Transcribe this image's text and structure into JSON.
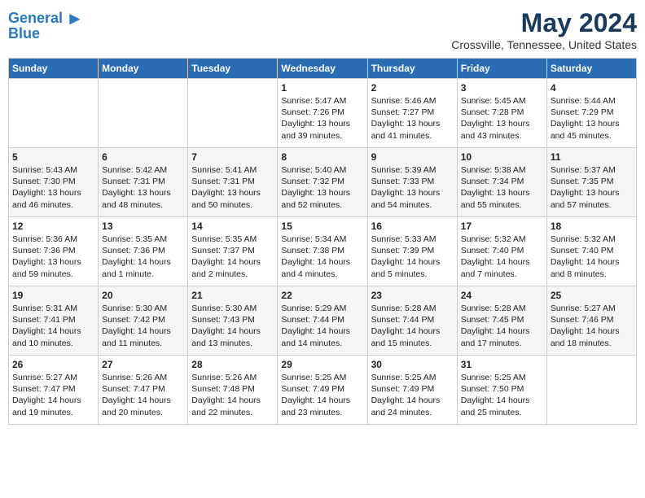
{
  "header": {
    "logo_line1": "General",
    "logo_line2": "Blue",
    "month": "May 2024",
    "location": "Crossville, Tennessee, United States"
  },
  "days_of_week": [
    "Sunday",
    "Monday",
    "Tuesday",
    "Wednesday",
    "Thursday",
    "Friday",
    "Saturday"
  ],
  "weeks": [
    [
      {
        "num": "",
        "info": ""
      },
      {
        "num": "",
        "info": ""
      },
      {
        "num": "",
        "info": ""
      },
      {
        "num": "1",
        "info": "Sunrise: 5:47 AM\nSunset: 7:26 PM\nDaylight: 13 hours\nand 39 minutes."
      },
      {
        "num": "2",
        "info": "Sunrise: 5:46 AM\nSunset: 7:27 PM\nDaylight: 13 hours\nand 41 minutes."
      },
      {
        "num": "3",
        "info": "Sunrise: 5:45 AM\nSunset: 7:28 PM\nDaylight: 13 hours\nand 43 minutes."
      },
      {
        "num": "4",
        "info": "Sunrise: 5:44 AM\nSunset: 7:29 PM\nDaylight: 13 hours\nand 45 minutes."
      }
    ],
    [
      {
        "num": "5",
        "info": "Sunrise: 5:43 AM\nSunset: 7:30 PM\nDaylight: 13 hours\nand 46 minutes."
      },
      {
        "num": "6",
        "info": "Sunrise: 5:42 AM\nSunset: 7:31 PM\nDaylight: 13 hours\nand 48 minutes."
      },
      {
        "num": "7",
        "info": "Sunrise: 5:41 AM\nSunset: 7:31 PM\nDaylight: 13 hours\nand 50 minutes."
      },
      {
        "num": "8",
        "info": "Sunrise: 5:40 AM\nSunset: 7:32 PM\nDaylight: 13 hours\nand 52 minutes."
      },
      {
        "num": "9",
        "info": "Sunrise: 5:39 AM\nSunset: 7:33 PM\nDaylight: 13 hours\nand 54 minutes."
      },
      {
        "num": "10",
        "info": "Sunrise: 5:38 AM\nSunset: 7:34 PM\nDaylight: 13 hours\nand 55 minutes."
      },
      {
        "num": "11",
        "info": "Sunrise: 5:37 AM\nSunset: 7:35 PM\nDaylight: 13 hours\nand 57 minutes."
      }
    ],
    [
      {
        "num": "12",
        "info": "Sunrise: 5:36 AM\nSunset: 7:36 PM\nDaylight: 13 hours\nand 59 minutes."
      },
      {
        "num": "13",
        "info": "Sunrise: 5:35 AM\nSunset: 7:36 PM\nDaylight: 14 hours\nand 1 minute."
      },
      {
        "num": "14",
        "info": "Sunrise: 5:35 AM\nSunset: 7:37 PM\nDaylight: 14 hours\nand 2 minutes."
      },
      {
        "num": "15",
        "info": "Sunrise: 5:34 AM\nSunset: 7:38 PM\nDaylight: 14 hours\nand 4 minutes."
      },
      {
        "num": "16",
        "info": "Sunrise: 5:33 AM\nSunset: 7:39 PM\nDaylight: 14 hours\nand 5 minutes."
      },
      {
        "num": "17",
        "info": "Sunrise: 5:32 AM\nSunset: 7:40 PM\nDaylight: 14 hours\nand 7 minutes."
      },
      {
        "num": "18",
        "info": "Sunrise: 5:32 AM\nSunset: 7:40 PM\nDaylight: 14 hours\nand 8 minutes."
      }
    ],
    [
      {
        "num": "19",
        "info": "Sunrise: 5:31 AM\nSunset: 7:41 PM\nDaylight: 14 hours\nand 10 minutes."
      },
      {
        "num": "20",
        "info": "Sunrise: 5:30 AM\nSunset: 7:42 PM\nDaylight: 14 hours\nand 11 minutes."
      },
      {
        "num": "21",
        "info": "Sunrise: 5:30 AM\nSunset: 7:43 PM\nDaylight: 14 hours\nand 13 minutes."
      },
      {
        "num": "22",
        "info": "Sunrise: 5:29 AM\nSunset: 7:44 PM\nDaylight: 14 hours\nand 14 minutes."
      },
      {
        "num": "23",
        "info": "Sunrise: 5:28 AM\nSunset: 7:44 PM\nDaylight: 14 hours\nand 15 minutes."
      },
      {
        "num": "24",
        "info": "Sunrise: 5:28 AM\nSunset: 7:45 PM\nDaylight: 14 hours\nand 17 minutes."
      },
      {
        "num": "25",
        "info": "Sunrise: 5:27 AM\nSunset: 7:46 PM\nDaylight: 14 hours\nand 18 minutes."
      }
    ],
    [
      {
        "num": "26",
        "info": "Sunrise: 5:27 AM\nSunset: 7:47 PM\nDaylight: 14 hours\nand 19 minutes."
      },
      {
        "num": "27",
        "info": "Sunrise: 5:26 AM\nSunset: 7:47 PM\nDaylight: 14 hours\nand 20 minutes."
      },
      {
        "num": "28",
        "info": "Sunrise: 5:26 AM\nSunset: 7:48 PM\nDaylight: 14 hours\nand 22 minutes."
      },
      {
        "num": "29",
        "info": "Sunrise: 5:25 AM\nSunset: 7:49 PM\nDaylight: 14 hours\nand 23 minutes."
      },
      {
        "num": "30",
        "info": "Sunrise: 5:25 AM\nSunset: 7:49 PM\nDaylight: 14 hours\nand 24 minutes."
      },
      {
        "num": "31",
        "info": "Sunrise: 5:25 AM\nSunset: 7:50 PM\nDaylight: 14 hours\nand 25 minutes."
      },
      {
        "num": "",
        "info": ""
      }
    ]
  ]
}
